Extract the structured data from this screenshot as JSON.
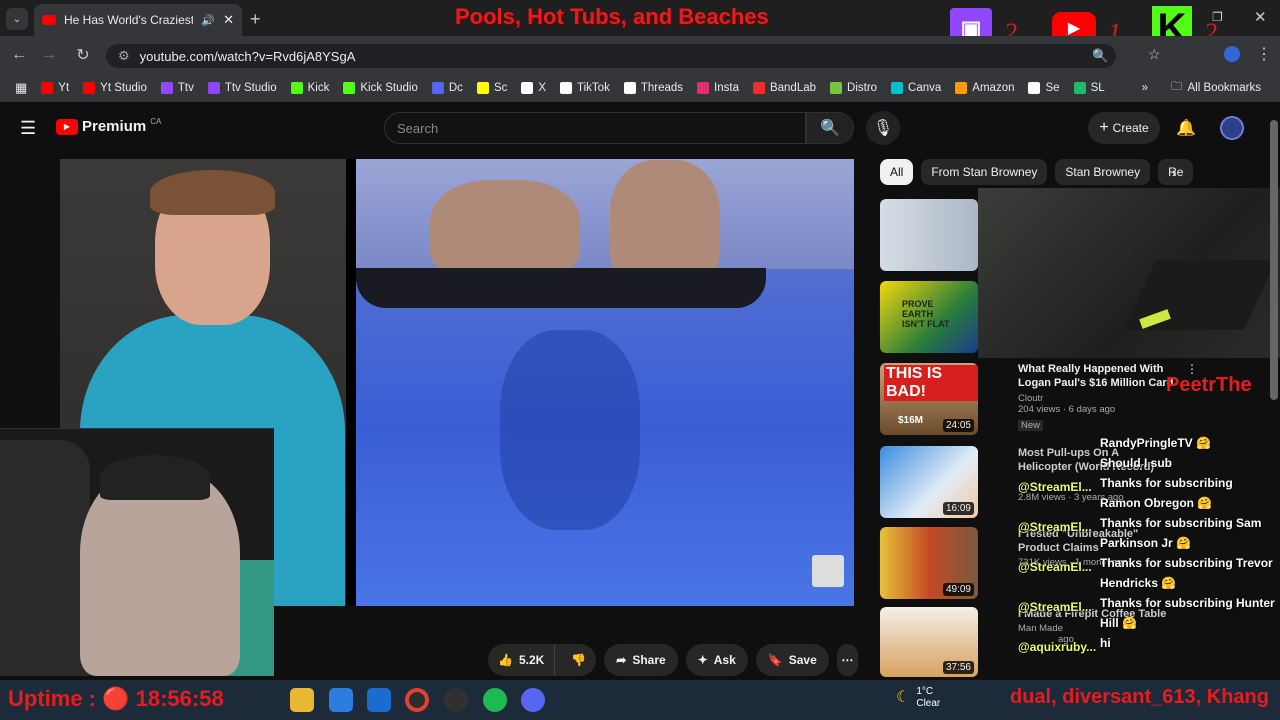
{
  "browser": {
    "tab_title": "He Has World's Craziest Bo",
    "url": "youtube.com/watch?v=Rvd6jA8YSgA",
    "bookmarks": [
      {
        "label": "Yt",
        "color": "#ff0000"
      },
      {
        "label": "Yt Studio",
        "color": "#ff0000"
      },
      {
        "label": "Ttv",
        "color": "#9146ff"
      },
      {
        "label": "Ttv Studio",
        "color": "#9146ff"
      },
      {
        "label": "Kick",
        "color": "#53fc18"
      },
      {
        "label": "Kick Studio",
        "color": "#53fc18"
      },
      {
        "label": "Dc",
        "color": "#5865f2"
      },
      {
        "label": "Sc",
        "color": "#fffc00"
      },
      {
        "label": "X",
        "color": "#ffffff"
      },
      {
        "label": "TikTok",
        "color": "#ffffff"
      },
      {
        "label": "Threads",
        "color": "#ffffff"
      },
      {
        "label": "Insta",
        "color": "#e1306c"
      },
      {
        "label": "BandLab",
        "color": "#f12c2c"
      },
      {
        "label": "Distro",
        "color": "#7cc242"
      },
      {
        "label": "Canva",
        "color": "#00c4cc"
      },
      {
        "label": "Amazon",
        "color": "#ff9900"
      },
      {
        "label": "Se",
        "color": "#ffffff"
      },
      {
        "label": "SL",
        "color": "#1fb86b"
      }
    ],
    "all_bookmarks": "All Bookmarks"
  },
  "overlay": {
    "stream_title": "Pools, Hot Tubs, and Beaches",
    "twitch_count": "2",
    "youtube_count": "1",
    "kick_count": "2",
    "uptime": "Uptime : 🔴 18:56:58",
    "ticker": "dual, diversant_613, Khang",
    "peetr": "PeetrThe"
  },
  "youtube": {
    "brand": "Premium",
    "region": "CA",
    "search_placeholder": "Search",
    "create_label": "Create",
    "chips": [
      "All",
      "From Stan Browney",
      "Stan Browney",
      "Re"
    ],
    "actions": {
      "likes": "5.2K",
      "share": "Share",
      "ask": "Ask",
      "save": "Save"
    },
    "related": [
      {
        "title": "",
        "meta": "",
        "duration": ""
      },
      {
        "title": "",
        "meta": "",
        "duration": ""
      },
      {
        "title": "What Really Happened With Logan Paul's $16 Million Card",
        "channel": "Cloutr",
        "meta": "204 views · 6 days ago",
        "badge": "New",
        "duration": "24:05"
      },
      {
        "title": "Most Pull-ups On A Helicopter (World Record)",
        "meta": "2.8M views · 3 years ago",
        "duration": "16:09"
      },
      {
        "title": "I Tested \"Unbreakable\" Product Claims",
        "meta": "731K views · 1 month ago",
        "duration": "49:09"
      },
      {
        "title": "I Made a Firepit Coffee Table",
        "channel": "Man Made",
        "meta": "ago",
        "duration": "37:56"
      }
    ]
  },
  "chat": [
    {
      "user": "",
      "msg": "RandyPringleTV 🤗"
    },
    {
      "user": "",
      "msg": "Should I sub"
    },
    {
      "user": "@StreamEl...",
      "msg": "Thanks for subscribing"
    },
    {
      "user": "",
      "msg": "Ramon Obregon 🤗"
    },
    {
      "user": "@StreamEl...",
      "msg": "Thanks for subscribing Sam"
    },
    {
      "user": "",
      "msg": "Parkinson Jr 🤗"
    },
    {
      "user": "@StreamEl...",
      "msg": "Thanks for subscribing Trevor"
    },
    {
      "user": "",
      "msg": "Hendricks 🤗"
    },
    {
      "user": "@StreamEl...",
      "msg": "Thanks for subscribing Hunter"
    },
    {
      "user": "",
      "msg": "Hill 🤗"
    },
    {
      "user": "@aquixruby...",
      "msg": "hi"
    }
  ],
  "taskbar": {
    "temp": "1°C",
    "weather": "Clear"
  }
}
